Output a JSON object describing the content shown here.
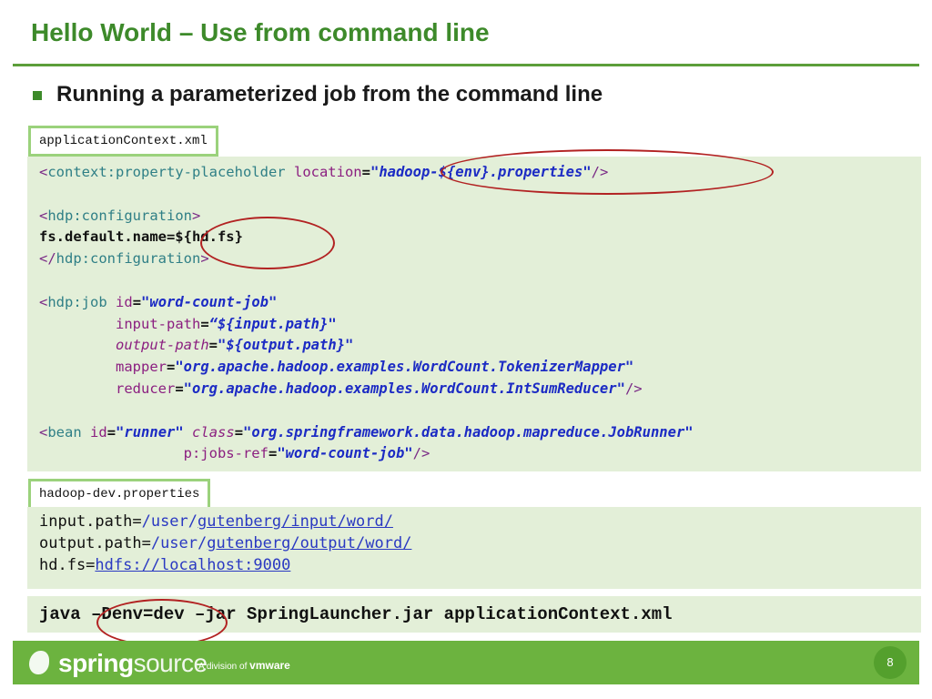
{
  "slide": {
    "title": "Hello World – Use from command line",
    "bullet": "Running a parameterized job from the command line",
    "page_number": "8"
  },
  "files": {
    "app_context_name": "applicationContext.xml",
    "properties_name": "hadoop-dev.properties"
  },
  "xml": {
    "l1_open": "<",
    "l1_tag": "context:property-placeholder",
    "l1_attr": "location",
    "l1_eq": "=",
    "l1_val": "\"hadoop-${env}.properties\"",
    "l1_close": "/>",
    "l3_open": "<",
    "l3_tag": "hdp:configuration",
    "l3_close": ">",
    "l4_text": "fs.default.name=${hd.fs}",
    "l5_open": "</",
    "l5_tag": "hdp:configuration",
    "l5_close": ">",
    "l7_open": "<",
    "l7_tag": "hdp:job",
    "l7_attr": "id",
    "l7_eq": "=",
    "l7_val": "\"word-count-job\"",
    "l8_indent": "         ",
    "l8_attr": "input-path",
    "l8_eq": "=",
    "l8_val": "“${input.path}\"",
    "l9_indent": "         ",
    "l9_attr": "output-path",
    "l9_eq": "=",
    "l9_val": "\"${output.path}\"",
    "l10_indent": "         ",
    "l10_attr": "mapper",
    "l10_eq": "=",
    "l10_val": "\"org.apache.hadoop.examples.WordCount.TokenizerMapper\"",
    "l11_indent": "         ",
    "l11_attr": "reducer",
    "l11_eq": "=",
    "l11_val": "\"org.apache.hadoop.examples.WordCount.IntSumReducer\"",
    "l11_close": "/>",
    "l13_open": "<",
    "l13_tag": "bean",
    "l13_attr1": "id",
    "l13_eq1": "=",
    "l13_val1": "\"runner\"",
    "l13_attr2": "class",
    "l13_eq2": "=",
    "l13_val2": "\"org.springframework.data.hadoop.mapreduce.JobRunner\"",
    "l14_indent": "                 ",
    "l14_attr": "p:jobs-ref",
    "l14_eq": "=",
    "l14_val": "\"word-count-job\"",
    "l14_close": "/>"
  },
  "properties": {
    "l1_key": "input.path=",
    "l1_val_a": "/user/",
    "l1_val_b": "gutenberg/input/word/",
    "l2_key": "output.path=",
    "l2_val_a": "/user/",
    "l2_val_b": "gutenberg/output/word/",
    "l3_key": "hd.fs=",
    "l3_val": "hdfs://localhost:9000"
  },
  "command": {
    "line": "java –Denv=dev –jar SpringLauncher.jar applicationContext.xml"
  },
  "footer": {
    "brand_a": "spring",
    "brand_b": "source",
    "division_prefix": "A division of ",
    "division_brand": "vmware"
  },
  "colors": {
    "title_green": "#3d8a2a",
    "footer_green": "#6cb33f",
    "code_bg": "#e3efd8",
    "highlight_circle": "#b22222"
  }
}
